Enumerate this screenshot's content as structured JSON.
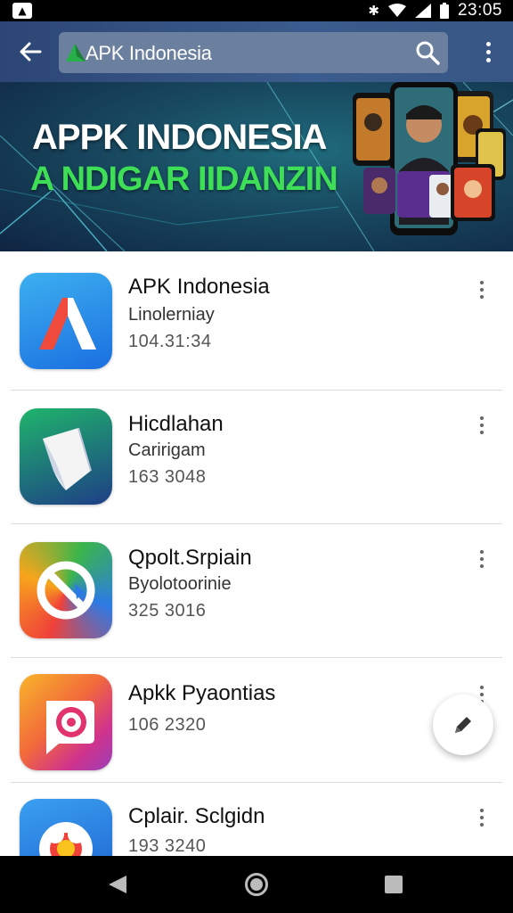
{
  "status_bar": {
    "time": "23:05",
    "icons": [
      "app-notification-icon",
      "bluetooth-icon",
      "wifi-icon",
      "signal-icon",
      "battery-icon"
    ]
  },
  "app_bar": {
    "search_value": "APK Indonesia",
    "icons": [
      "back-arrow-icon",
      "search-icon",
      "more-vert-icon"
    ]
  },
  "banner": {
    "title": "APPK INDONESIA",
    "subtitle": "A NDIGAR IIDANZIN"
  },
  "apps": [
    {
      "name": "APK Indonesia",
      "subtitle": "Linolerniay",
      "number": "104.31:34",
      "icon": "apk-a-icon"
    },
    {
      "name": "Hicdlahan",
      "subtitle": "Caririgam",
      "number": "163 3048",
      "icon": "document-icon"
    },
    {
      "name": "Qpolt.Srpiain",
      "subtitle": "Byolotoorinie",
      "number": "325 3016",
      "icon": "no-sign-icon"
    },
    {
      "name": "Apkk Pyaontias",
      "subtitle": "",
      "number": "106 2320",
      "icon": "chat-bubble-icon"
    },
    {
      "name": "Cplair. Sclgidn",
      "subtitle": "",
      "number": "193 3240",
      "icon": "flower-icon"
    }
  ],
  "colors": {
    "app_bar": "#3b5c8e",
    "banner_green": "#3fde57",
    "nav_bar": "#000000"
  }
}
